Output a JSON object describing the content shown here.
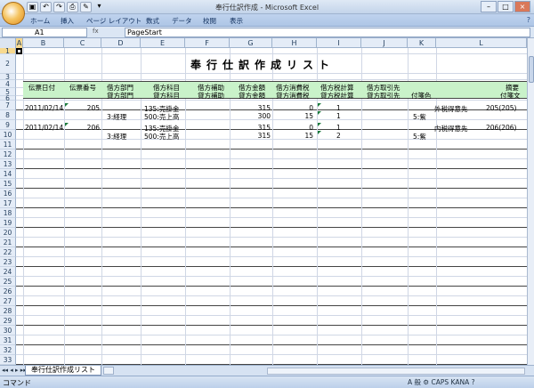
{
  "window": {
    "title": "奉行仕訳作成 - Microsoft Excel",
    "minimize": "–",
    "restore": "□",
    "close": "×"
  },
  "quick_access": [
    "save-icon",
    "undo-icon",
    "redo-icon",
    "print-preview-icon",
    "export-icon",
    "customize-icon"
  ],
  "ribbon": {
    "tabs": [
      "ホーム",
      "挿入",
      "ページ レイアウト",
      "数式",
      "データ",
      "校閲",
      "表示"
    ],
    "help": "?"
  },
  "formula_bar": {
    "name_box": "A1",
    "fx": "fx",
    "content": "PageStart"
  },
  "columns": [
    "A",
    "B",
    "C",
    "D",
    "E",
    "F",
    "G",
    "H",
    "I",
    "J",
    "K",
    "L"
  ],
  "rows": [
    "1",
    "2",
    "3",
    "4",
    "5",
    "6",
    "7",
    "8",
    "9",
    "10",
    "11",
    "12",
    "13",
    "14",
    "15",
    "16",
    "17",
    "18",
    "19",
    "20",
    "21",
    "22",
    "23",
    "24",
    "25",
    "26",
    "27",
    "28",
    "29",
    "30",
    "31",
    "32",
    "33",
    "34"
  ],
  "report": {
    "title": "奉行仕訳作成リスト",
    "headers_top": [
      "伝票日付",
      "伝票番号",
      "借方部門",
      "借方科目",
      "借方補助",
      "借方金額",
      "借方消費税",
      "借方税計算",
      "借方取引先",
      "",
      "",
      "摘要"
    ],
    "headers_bottom": [
      "",
      "",
      "貸方部門",
      "貸方科目",
      "貸方補助",
      "貸方金額",
      "貸方消費税",
      "貸方税計算",
      "貸方取引先",
      "付箋色",
      "",
      "付箋文"
    ]
  },
  "entries": [
    {
      "debit": {
        "date": "2011/02/14",
        "number": "205",
        "dept": "",
        "account": "135:売掛金",
        "amount": "315",
        "tax": "0",
        "taxcalc": "1",
        "memo_label": "外税得意先",
        "memo": "205(205)"
      },
      "credit": {
        "dept": "3:経理",
        "account": "500:売上高",
        "amount": "300",
        "tax": "15",
        "taxcalc": "1",
        "tag_color": "5:紫"
      }
    },
    {
      "debit": {
        "date": "2011/02/14",
        "number": "206",
        "dept": "",
        "account": "135:売掛金",
        "amount": "315",
        "tax": "0",
        "taxcalc": "1",
        "memo_label": "内税得意先",
        "memo": "206(206)"
      },
      "credit": {
        "dept": "3:経理",
        "account": "500:売上高",
        "amount": "315",
        "tax": "15",
        "taxcalc": "2",
        "tag_color": "5:紫"
      }
    }
  ],
  "sheet_tabs": {
    "nav": "◂◂ ◂ ▸ ▸▸",
    "active": "奉行仕訳作成リスト"
  },
  "status": {
    "mode": "コマンド",
    "right": "A 般 ⚙ CAPS KANA ?"
  }
}
